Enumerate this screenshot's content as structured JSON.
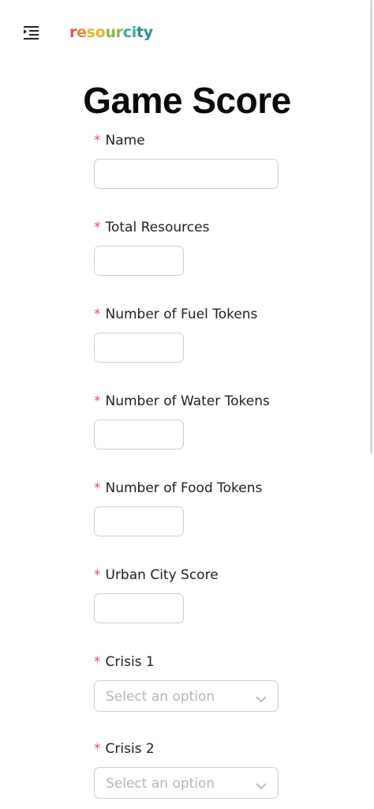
{
  "header": {
    "menu_icon": "menu-indent-icon",
    "brand": {
      "parts": [
        "r",
        "e",
        "so",
        "ur",
        "ci",
        "ty"
      ],
      "colors": [
        "#e0506a",
        "#f0804a",
        "#e8b530",
        "#8cb84c",
        "#3aa89a",
        "#2c8f8a"
      ]
    }
  },
  "form": {
    "title": "Game Score",
    "required_marker": "*",
    "fields": [
      {
        "label": "Name",
        "type": "text",
        "value": ""
      },
      {
        "label": "Total Resources",
        "type": "number",
        "value": ""
      },
      {
        "label": "Number of Fuel Tokens",
        "type": "number",
        "value": ""
      },
      {
        "label": "Number of Water Tokens",
        "type": "number",
        "value": ""
      },
      {
        "label": "Number of Food Tokens",
        "type": "number",
        "value": ""
      },
      {
        "label": "Urban City Score",
        "type": "number",
        "value": ""
      },
      {
        "label": "Crisis 1",
        "type": "select",
        "placeholder": "Select an option"
      },
      {
        "label": "Crisis 2",
        "type": "select",
        "placeholder": "Select an option"
      }
    ]
  },
  "colors": {
    "required": "#e0505a",
    "border": "#cfcfcf",
    "placeholder": "#b5b5b5"
  }
}
